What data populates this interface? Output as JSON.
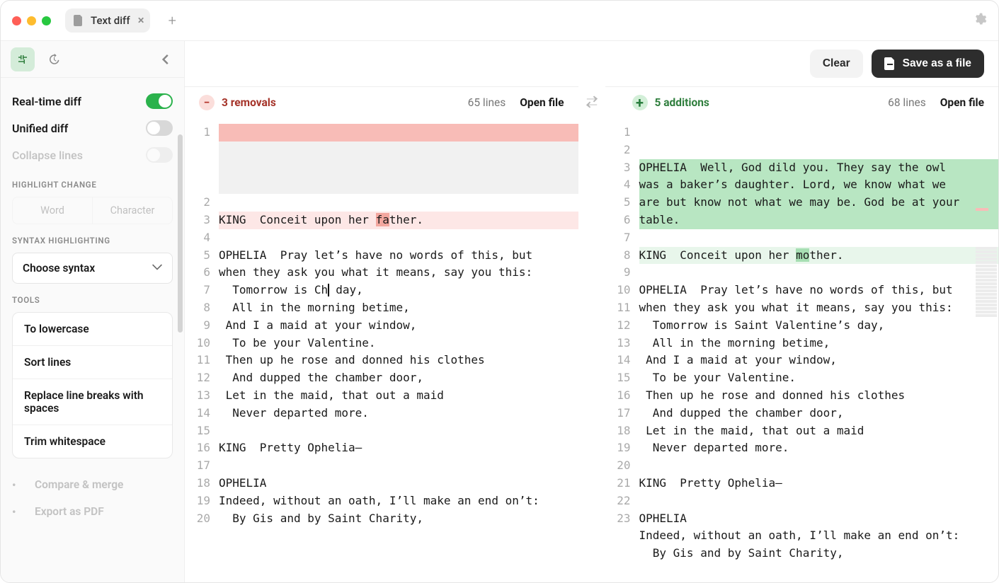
{
  "titlebar": {
    "tab_title": "Text diff"
  },
  "sidebar": {
    "realtime_label": "Real-time diff",
    "unified_label": "Unified diff",
    "collapse_label": "Collapse lines",
    "highlight_section": "HIGHLIGHT CHANGE",
    "seg_word": "Word",
    "seg_char": "Character",
    "syntax_section": "SYNTAX HIGHLIGHTING",
    "syntax_value": "Choose syntax",
    "tools_section": "TOOLS",
    "tools": [
      "To lowercase",
      "Sort lines",
      "Replace line breaks with spaces",
      "Trim whitespace"
    ],
    "dim": [
      "Compare & merge",
      "Export as PDF"
    ]
  },
  "toolbar": {
    "clear": "Clear",
    "save": "Save as a file"
  },
  "left": {
    "summary": "3 removals",
    "lines_text": "65 lines",
    "open": "Open file",
    "rows": [
      {
        "n": 1,
        "t": "",
        "cls": "del-full"
      },
      {
        "n": "",
        "t": "",
        "cls": "pad"
      },
      {
        "n": "",
        "t": "",
        "cls": "pad"
      },
      {
        "n": "",
        "t": "",
        "cls": "pad"
      },
      {
        "n": 2,
        "t": ""
      },
      {
        "n": 3,
        "t": "KING  Conceit upon her <span class=\"hl-del\">fa</span>ther.",
        "cls": "del-soft"
      },
      {
        "n": 4,
        "t": ""
      },
      {
        "n": 5,
        "t": "OPHELIA  Pray let’s have no words of this, but"
      },
      {
        "n": 6,
        "t": "when they ask you what it means, say you this:"
      },
      {
        "n": 7,
        "t": "  Tomorrow is Ch<span class=\"cursor\"></span> day,"
      },
      {
        "n": 8,
        "t": "  All in the morning betime,"
      },
      {
        "n": 9,
        "t": " And I a maid at your window,"
      },
      {
        "n": 10,
        "t": "  To be your Valentine."
      },
      {
        "n": 11,
        "t": " Then up he rose and donned his clothes"
      },
      {
        "n": 12,
        "t": "  And dupped the chamber door,"
      },
      {
        "n": 13,
        "t": " Let in the maid, that out a maid"
      },
      {
        "n": 14,
        "t": "  Never departed more."
      },
      {
        "n": 15,
        "t": ""
      },
      {
        "n": 16,
        "t": "KING  Pretty Ophelia—"
      },
      {
        "n": 17,
        "t": ""
      },
      {
        "n": 18,
        "t": "OPHELIA"
      },
      {
        "n": 19,
        "t": "Indeed, without an oath, I’ll make an end on’t:"
      },
      {
        "n": 20,
        "t": "  By Gis and by Saint Charity,"
      }
    ]
  },
  "right": {
    "summary": "5 additions",
    "lines_text": "68 lines",
    "open": "Open file",
    "rows": [
      {
        "n": 1,
        "t": "OPHELIA  Well, God dild you. They say the owl",
        "cls": "add-full"
      },
      {
        "n": 2,
        "t": "was a baker’s daughter. Lord, we know what we",
        "cls": "add-full"
      },
      {
        "n": 3,
        "t": "are but know not what we may be. God be at your",
        "cls": "add-full"
      },
      {
        "n": 4,
        "t": "table.",
        "cls": "add-full"
      },
      {
        "n": 5,
        "t": ""
      },
      {
        "n": 6,
        "t": "KING  Conceit upon her <span class=\"hl-add\">mo</span>ther.",
        "cls": "add-soft"
      },
      {
        "n": 7,
        "t": ""
      },
      {
        "n": 8,
        "t": "OPHELIA  Pray let’s have no words of this, but"
      },
      {
        "n": 9,
        "t": "when they ask you what it means, say you this:"
      },
      {
        "n": 10,
        "t": "  Tomorrow is Saint Valentine’s day,"
      },
      {
        "n": 11,
        "t": "  All in the morning betime,"
      },
      {
        "n": 12,
        "t": " And I a maid at your window,"
      },
      {
        "n": 13,
        "t": "  To be your Valentine."
      },
      {
        "n": 14,
        "t": " Then up he rose and donned his clothes"
      },
      {
        "n": 15,
        "t": "  And dupped the chamber door,"
      },
      {
        "n": 16,
        "t": " Let in the maid, that out a maid"
      },
      {
        "n": 17,
        "t": "  Never departed more."
      },
      {
        "n": 18,
        "t": ""
      },
      {
        "n": 19,
        "t": "KING  Pretty Ophelia—"
      },
      {
        "n": 20,
        "t": ""
      },
      {
        "n": 21,
        "t": "OPHELIA"
      },
      {
        "n": 22,
        "t": "Indeed, without an oath, I’ll make an end on’t:"
      },
      {
        "n": 23,
        "t": "  By Gis and by Saint Charity,"
      }
    ]
  }
}
